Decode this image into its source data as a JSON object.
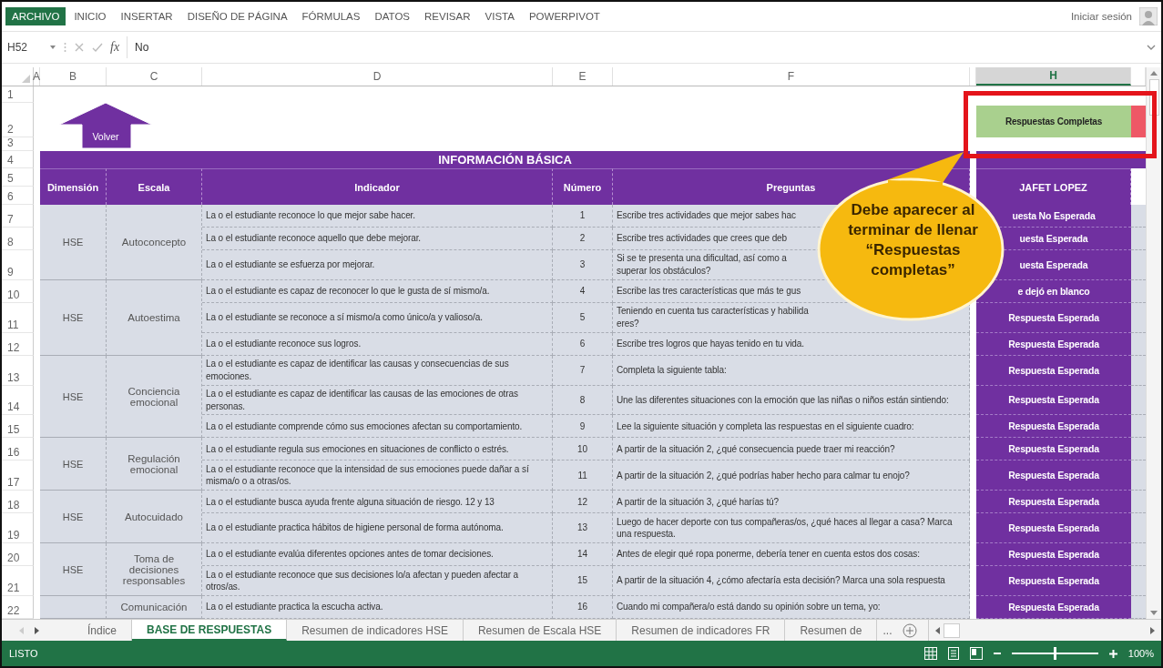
{
  "ribbon": {
    "tabs": [
      {
        "label": "ARCHIVO",
        "selected": true
      },
      {
        "label": "INICIO",
        "selected": false
      },
      {
        "label": "INSERTAR",
        "selected": false
      },
      {
        "label": "DISEÑO DE PÁGINA",
        "selected": false
      },
      {
        "label": "FÓRMULAS",
        "selected": false
      },
      {
        "label": "DATOS",
        "selected": false
      },
      {
        "label": "REVISAR",
        "selected": false
      },
      {
        "label": "VISTA",
        "selected": false
      },
      {
        "label": "POWERPIVOT",
        "selected": false
      }
    ],
    "account": "Iniciar sesión"
  },
  "formula_bar": {
    "cell": "H52",
    "function_label": "fx",
    "formula": "No"
  },
  "columns": [
    {
      "letter": "A",
      "selected": false
    },
    {
      "letter": "B",
      "selected": false
    },
    {
      "letter": "C",
      "selected": false
    },
    {
      "letter": "D",
      "selected": false
    },
    {
      "letter": "E",
      "selected": false
    },
    {
      "letter": "F",
      "selected": false
    },
    {
      "selected": false
    },
    {
      "letter": "H",
      "selected": true
    }
  ],
  "sheet": {
    "header_rows": [
      "1",
      "2",
      "3",
      "4",
      "5",
      "6"
    ],
    "back_button": "Volver",
    "status_button": "Respuestas Completas",
    "banner": "INFORMACIÓN BÁSICA",
    "table_headers": [
      "Dimensión",
      "Escala",
      "Indicador",
      "Número",
      "Preguntas",
      "JAFET LOPEZ"
    ],
    "groups": [
      {
        "dimension": "HSE",
        "escala": "Autoconcepto",
        "items": [
          {
            "row": "7",
            "indicador": "La o el estudiante reconoce lo que mejor sabe hacer.",
            "numero": "1",
            "pregunta": "Escribe tres actividades que mejor sabes hac",
            "resultado": "uesta No Esperada"
          },
          {
            "row": "8",
            "indicador": "La o el estudiante reconoce aquello que debe mejorar.",
            "numero": "2",
            "pregunta": "Escribe tres actividades que crees que deb",
            "resultado": "uesta Esperada"
          },
          {
            "row": "9",
            "indicador": "La o el estudiante se esfuerza por mejorar.",
            "numero": "3",
            "pregunta": "Si se te presenta una dificultad, así como a\nsuperar los obstáculos?",
            "resultado": "uesta Esperada"
          }
        ]
      },
      {
        "dimension": "HSE",
        "escala": "Autoestima",
        "items": [
          {
            "row": "10",
            "indicador": "La o el estudiante es capaz de reconocer lo que le gusta de sí mismo/a.",
            "numero": "4",
            "pregunta": "Escribe las tres características que más te gus",
            "resultado": "e dejó en blanco"
          },
          {
            "row": "11",
            "indicador": "La o el estudiante se reconoce a sí mismo/a como único/a y valioso/a.",
            "numero": "5",
            "pregunta": "Teniendo en cuenta tus características y habilida\neres?",
            "resultado": "Respuesta Esperada"
          },
          {
            "row": "12",
            "indicador": "La o el estudiante reconoce sus logros.",
            "numero": "6",
            "pregunta": "Escribe tres logros que hayas tenido en tu vida.",
            "resultado": "Respuesta Esperada"
          }
        ]
      },
      {
        "dimension": "HSE",
        "escala": "Conciencia emocional",
        "items": [
          {
            "row": "13",
            "indicador": "La o el estudiante es capaz de identificar las causas y consecuencias de sus emociones.",
            "numero": "7",
            "pregunta": "Completa la siguiente tabla:",
            "resultado": "Respuesta Esperada"
          },
          {
            "row": "14",
            "indicador": "La o el estudiante es capaz de identificar las causas de las emociones de otras personas.",
            "numero": "8",
            "pregunta": "Une las diferentes situaciones con la emoción que las niñas o niños están sintiendo:",
            "resultado": "Respuesta Esperada"
          },
          {
            "row": "15",
            "indicador": "La o el estudiante comprende cómo sus emociones afectan su comportamiento.",
            "numero": "9",
            "pregunta": "Lee la siguiente situación y completa las respuestas en el siguiente cuadro:",
            "resultado": "Respuesta Esperada"
          }
        ]
      },
      {
        "dimension": "HSE",
        "escala": "Regulación emocional",
        "items": [
          {
            "row": "16",
            "indicador": "La o el estudiante regula sus emociones en situaciones de conflicto o estrés.",
            "numero": "10",
            "pregunta": "A partir de la situación 2, ¿qué consecuencia puede traer mi reacción?",
            "resultado": "Respuesta Esperada"
          },
          {
            "row": "17",
            "indicador": "La o el estudiante reconoce que la intensidad de sus emociones puede dañar a sí misma/o o a otras/os.",
            "numero": "11",
            "pregunta": "A partir de la situación 2, ¿qué podrías haber hecho para calmar tu enojo?",
            "resultado": "Respuesta Esperada"
          }
        ]
      },
      {
        "dimension": "HSE",
        "escala": "Autocuidado",
        "items": [
          {
            "row": "18",
            "indicador": "La o el estudiante busca ayuda frente alguna situación de riesgo. 12 y 13",
            "numero": "12",
            "pregunta": "A partir de la situación 3, ¿qué harías tú?",
            "resultado": "Respuesta Esperada"
          },
          {
            "row": "19",
            "indicador": "La o el estudiante practica hábitos de higiene personal de forma autónoma.",
            "numero": "13",
            "pregunta": "Luego de hacer deporte con tus compañeras/os, ¿qué haces al llegar a casa? Marca una respuesta.",
            "resultado": "Respuesta Esperada"
          }
        ]
      },
      {
        "dimension": "HSE",
        "escala": "Toma de decisiones responsables",
        "items": [
          {
            "row": "20",
            "indicador": "La o el estudiante evalúa diferentes opciones antes de tomar decisiones.",
            "numero": "14",
            "pregunta": "Antes de elegir qué ropa ponerme, debería tener en cuenta estos dos cosas:",
            "resultado": "Respuesta Esperada"
          },
          {
            "row": "21",
            "indicador": "La o el estudiante reconoce que sus decisiones lo/a afectan y pueden afectar a otros/as.",
            "numero": "15",
            "pregunta": "A partir de la situación 4, ¿cómo afectaría esta decisión? Marca una sola respuesta",
            "resultado": "Respuesta Esperada"
          }
        ]
      },
      {
        "escala": "Comunicación",
        "items": [
          {
            "row": "22",
            "indicador": "La o el estudiante practica la escucha activa.",
            "numero": "16",
            "pregunta": "Cuando mi compañera/o está dando su opinión sobre un tema, yo:",
            "resultado": "Respuesta Esperada"
          }
        ]
      }
    ]
  },
  "callout": "Debe aparecer al\nterminar de llenar\n“Respuestas\ncompletas”",
  "sheet_tabs": [
    {
      "label": "Índice",
      "selected": false
    },
    {
      "label": "BASE DE RESPUESTAS",
      "selected": true
    },
    {
      "label": "Resumen de indicadores HSE",
      "selected": false
    },
    {
      "label": "Resumen de Escala HSE",
      "selected": false
    },
    {
      "label": "Resumen de indicadores FR",
      "selected": false
    },
    {
      "label": "Resumen de",
      "selected": false
    }
  ],
  "more_tabs": "...",
  "status_bar": {
    "text": "LISTO",
    "zoom": {
      "level": 0.5,
      "reading": "100%"
    }
  }
}
